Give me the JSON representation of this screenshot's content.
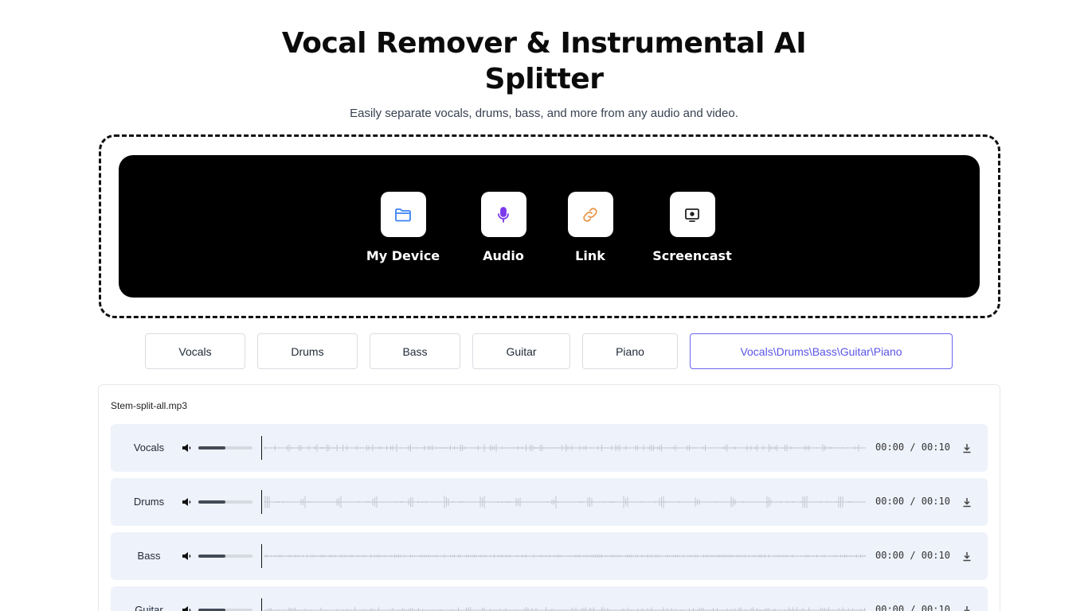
{
  "header": {
    "title_line1": "Vocal Remover & Instrumental AI",
    "title_line2": "Splitter",
    "subtitle": "Easily separate vocals, drums, bass, and more from any audio and video."
  },
  "sources": [
    {
      "label": "My Device",
      "icon": "folder-icon",
      "color": "#3b82f6"
    },
    {
      "label": "Audio",
      "icon": "microphone-icon",
      "color": "#7c3aed"
    },
    {
      "label": "Link",
      "icon": "link-icon",
      "color": "#e8954a"
    },
    {
      "label": "Screencast",
      "icon": "screen-record-icon",
      "color": "#222222"
    }
  ],
  "tabs": [
    {
      "label": "Vocals"
    },
    {
      "label": "Drums"
    },
    {
      "label": "Bass"
    },
    {
      "label": "Guitar"
    },
    {
      "label": "Piano"
    },
    {
      "label": "Vocals\\Drums\\Bass\\Guitar\\Piano",
      "active": true
    }
  ],
  "result": {
    "file_name": "Stem-split-all.mp3",
    "tracks": [
      {
        "name": "Vocals",
        "time": "00:00 / 00:10",
        "volume": 0.5
      },
      {
        "name": "Drums",
        "time": "00:00 / 00:10",
        "volume": 0.5
      },
      {
        "name": "Bass",
        "time": "00:00 / 00:10",
        "volume": 0.5
      },
      {
        "name": "Guitar",
        "time": "00:00 / 00:10",
        "volume": 0.5
      }
    ]
  },
  "colors": {
    "accent": "#5a55e8",
    "track_bg": "#eef2fa",
    "waveform": "#c3c7cf"
  }
}
